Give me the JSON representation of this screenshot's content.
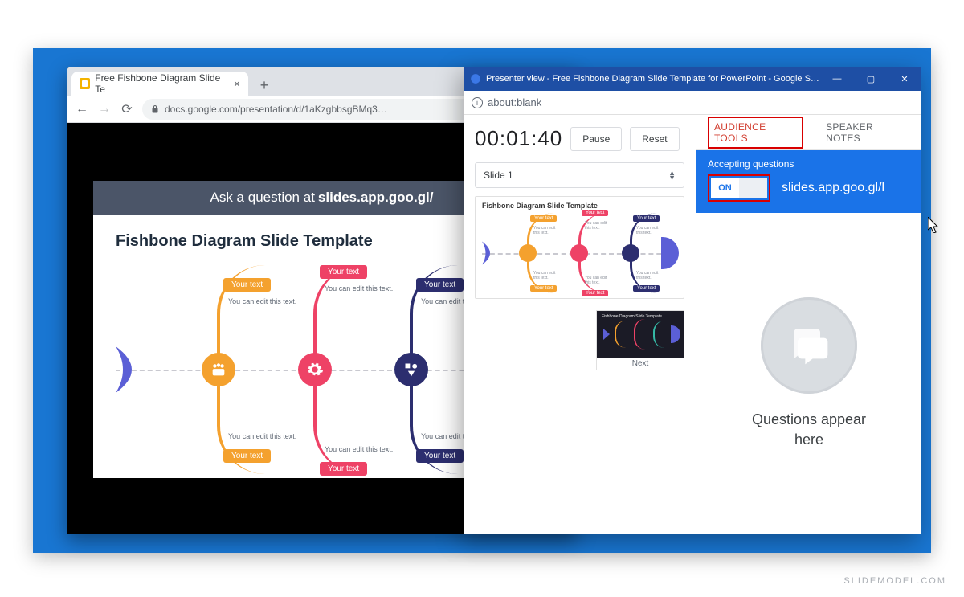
{
  "chrome": {
    "tab_title": "Free Fishbone Diagram Slide Te",
    "url": "docs.google.com/presentation/d/1aKzgbbsgBMq3…"
  },
  "banner": {
    "prefix": "Ask a question at ",
    "link": "slides.app.goo.gl/"
  },
  "slide": {
    "title": "Fishbone Diagram Slide Template",
    "your_text": "Your text",
    "caption": "You can edit this text."
  },
  "presenter": {
    "window_title": "Presenter view - Free Fishbone Diagram Slide Template for PowerPoint - Google S…",
    "address": "about:blank",
    "timer": "00:01:40",
    "pause": "Pause",
    "reset": "Reset",
    "slide_select": "Slide 1",
    "thumb_title": "Fishbone Diagram Slide Template",
    "next_label": "Next",
    "next_thumb_title": "Fishbone Diagram Slide Template",
    "tabs": {
      "audience": "AUDIENCE TOOLS",
      "notes": "SPEAKER NOTES"
    },
    "accepting_label": "Accepting questions",
    "toggle_on": "ON",
    "qa_link": "slides.app.goo.gl/l",
    "empty_text": "Questions appear here"
  },
  "watermark": "SLIDEMODEL.COM",
  "colors": {
    "orange": "#f4a12e",
    "pink": "#ee4266",
    "navy": "#2c2e6f",
    "indigo": "#5b5fd6"
  }
}
